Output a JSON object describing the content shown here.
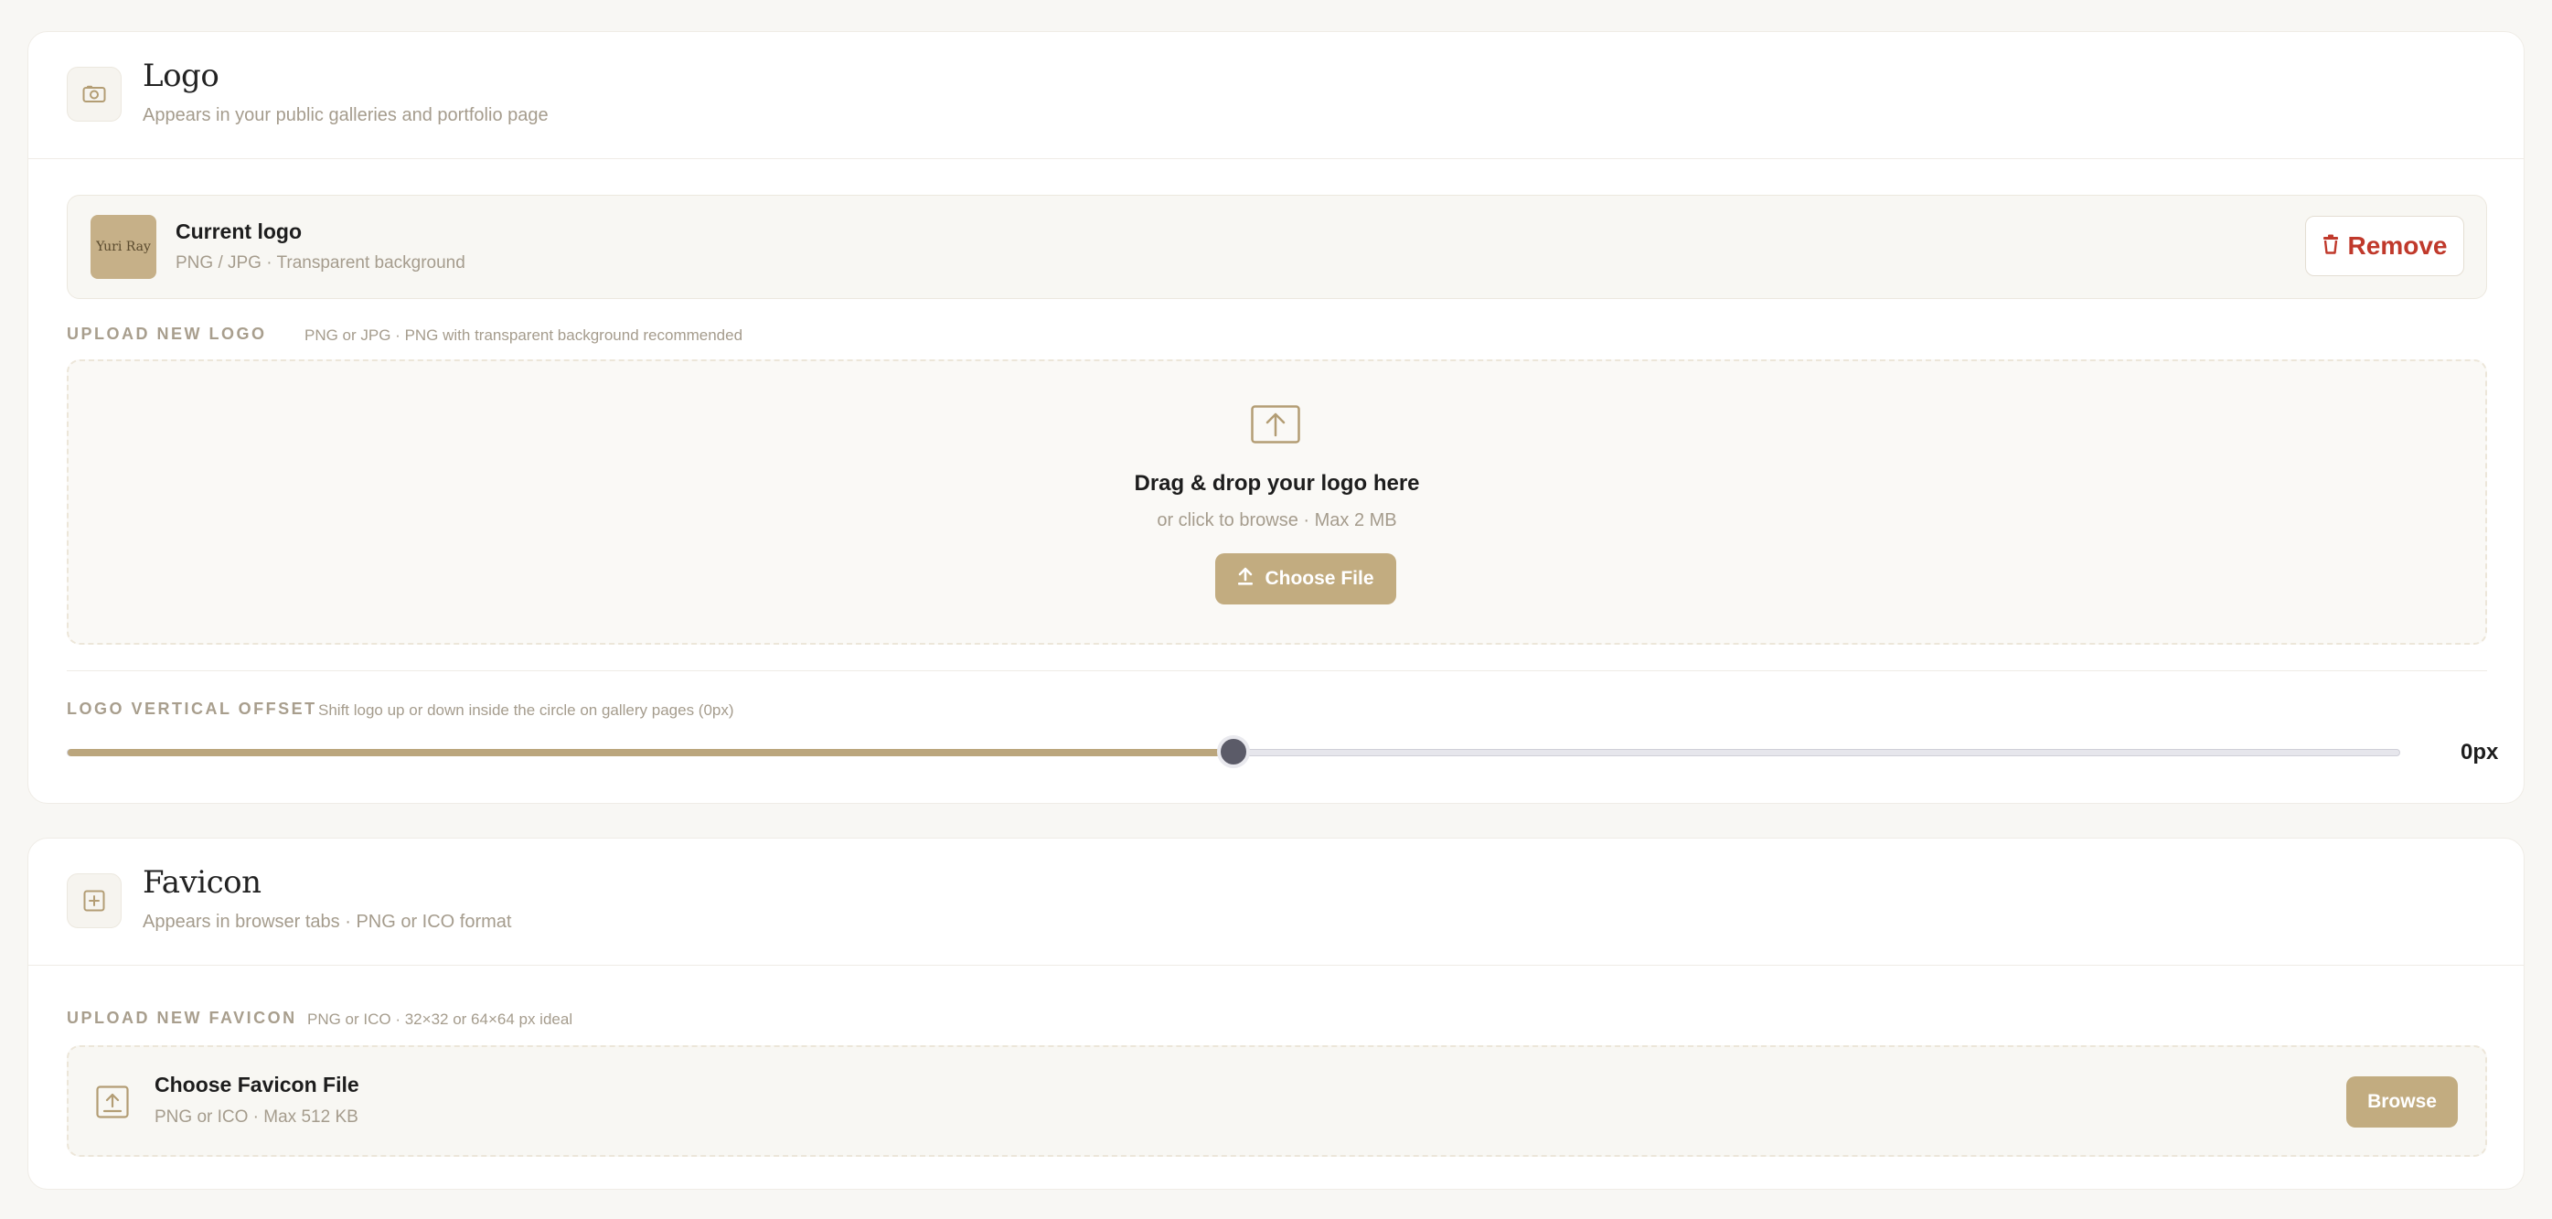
{
  "colors": {
    "accent": "#c2ac80",
    "danger": "#c0392b",
    "background": "#f8f7f4"
  },
  "logo_section": {
    "title": "Logo",
    "subtitle": "Appears in your public galleries and portfolio page",
    "icon": "camera-icon",
    "current_logo": {
      "thumbnail_text": "Yuri Ray",
      "title": "Current logo",
      "subtitle": "PNG / JPG · Transparent background",
      "remove_label": "Remove"
    },
    "upload": {
      "label": "UPLOAD NEW LOGO",
      "hint": "PNG or JPG · PNG with transparent background recommended",
      "drop_title": "Drag & drop your logo here",
      "drop_subtitle": "or click to browse · Max 2 MB",
      "button_label": "Choose File"
    },
    "offset": {
      "label": "LOGO VERTICAL OFFSET",
      "hint": "Shift logo up or down inside the circle on gallery pages (0px)",
      "value_text": "0px",
      "slider_position_fraction": 0.5
    }
  },
  "favicon_section": {
    "title": "Favicon",
    "subtitle": "Appears in browser tabs · PNG or ICO format",
    "icon": "plus-square-icon",
    "upload": {
      "label": "UPLOAD NEW FAVICON",
      "hint": "PNG or ICO · 32×32 or 64×64 px ideal",
      "file_title": "Choose Favicon File",
      "file_subtitle": "PNG or ICO · Max 512 KB",
      "button_label": "Browse"
    }
  }
}
